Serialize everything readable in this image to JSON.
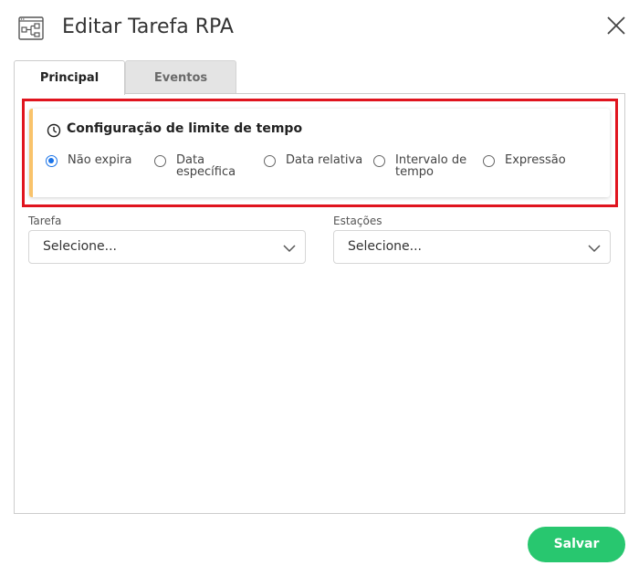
{
  "dialog": {
    "title": "Editar Tarefa RPA",
    "header_icon": "workflow-diagram-icon",
    "close_icon": "close-icon"
  },
  "tabs": [
    {
      "label": "Principal",
      "active": true
    },
    {
      "label": "Eventos",
      "active": false
    }
  ],
  "timeout_config": {
    "title": "Configuração de limite de tempo",
    "icon": "clock-icon",
    "accent_color": "#f9c36b",
    "options": [
      {
        "line1": "Não expira",
        "line2": "",
        "checked": true
      },
      {
        "line1": "Data",
        "line2": "específica",
        "checked": false
      },
      {
        "line1": "Data relativa",
        "line2": "",
        "checked": false
      },
      {
        "line1": "Intervalo de",
        "line2": "tempo",
        "checked": false
      },
      {
        "line1": "Expressão",
        "line2": "",
        "checked": false
      }
    ]
  },
  "fields": {
    "tarefa": {
      "label": "Tarefa",
      "value": "Selecione..."
    },
    "estacoes": {
      "label": "Estações",
      "value": "Selecione..."
    }
  },
  "footer": {
    "save_label": "Salvar",
    "save_color": "#28c76f"
  },
  "colors": {
    "highlight_border": "#e0141e",
    "radio_selected": "#1a73e8"
  }
}
